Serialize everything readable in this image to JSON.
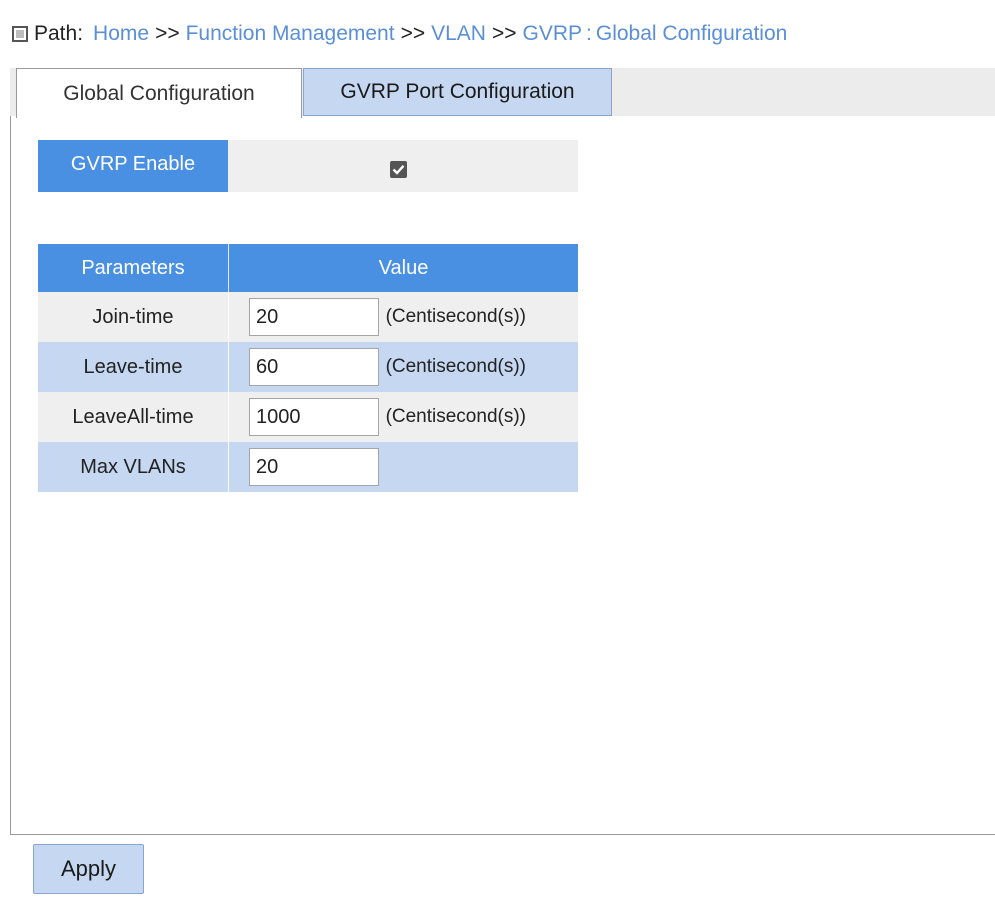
{
  "path": {
    "label": "Path:",
    "crumbs": [
      "Home",
      "Function Management",
      "VLAN",
      "GVRP"
    ],
    "separator": ">>",
    "colon": ":",
    "current": "Global Configuration"
  },
  "tabs": [
    {
      "label": "Global Configuration",
      "active": true
    },
    {
      "label": "GVRP Port Configuration",
      "active": false
    }
  ],
  "gvrp_enable": {
    "label": "GVRP Enable",
    "checked": true
  },
  "params_table": {
    "headers": {
      "parameters": "Parameters",
      "value": "Value"
    },
    "rows": [
      {
        "name": "Join-time",
        "value": "20",
        "unit": "(Centisecond(s))"
      },
      {
        "name": "Leave-time",
        "value": "60",
        "unit": "(Centisecond(s))"
      },
      {
        "name": "LeaveAll-time",
        "value": "1000",
        "unit": "(Centisecond(s))"
      },
      {
        "name": "Max VLANs",
        "value": "20",
        "unit": ""
      }
    ]
  },
  "apply_label": "Apply",
  "colors": {
    "accent": "#4a90e2",
    "link": "#5a8fd8",
    "tab_inactive": "#c6d8f1",
    "row_alt": "#c6d8f1",
    "row_plain": "#efefef"
  }
}
